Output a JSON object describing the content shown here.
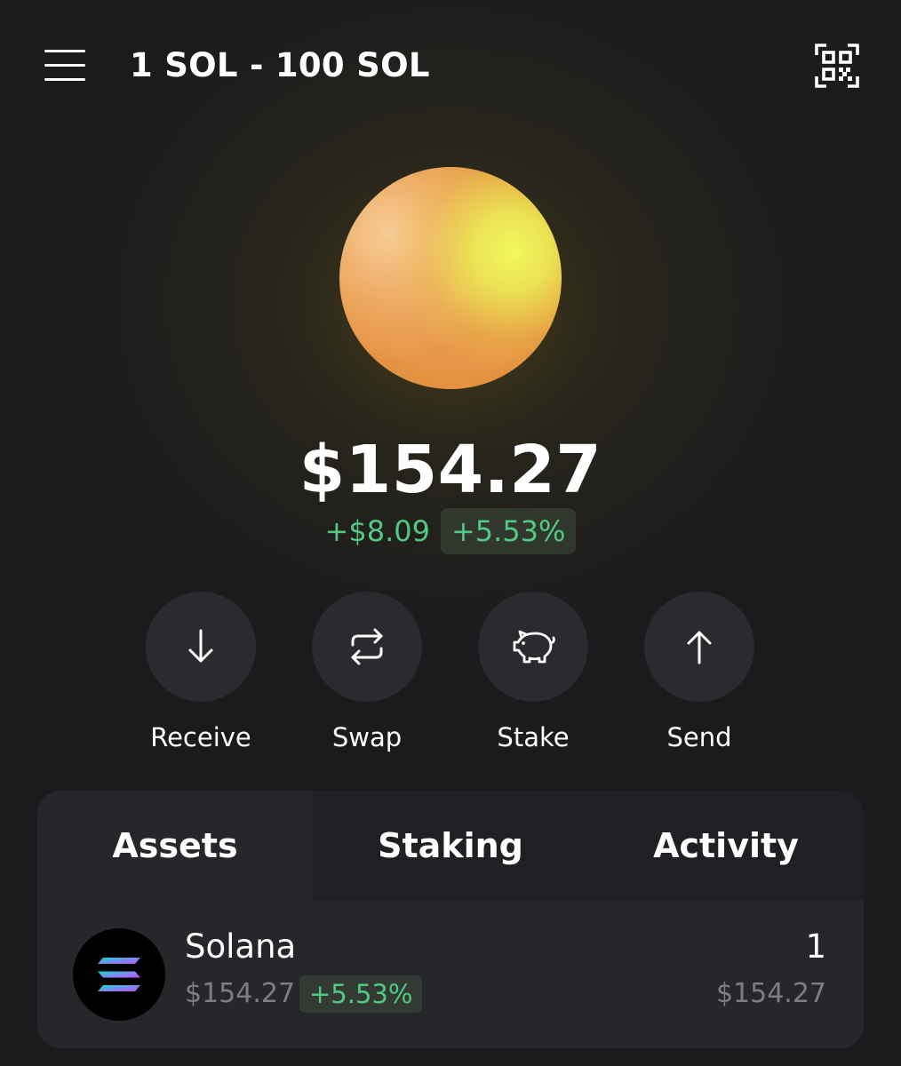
{
  "header": {
    "title": "1 SOL - 100 SOL",
    "menu_icon": "hamburger-menu-icon",
    "qr_icon": "qr-scan-icon"
  },
  "portfolio": {
    "balance": "$154.27",
    "change_amount": "+$8.09",
    "change_percent": "+5.53%",
    "positive_color": "#52c983"
  },
  "actions": [
    {
      "label": "Receive",
      "icon": "arrow-down-icon"
    },
    {
      "label": "Swap",
      "icon": "swap-arrows-icon"
    },
    {
      "label": "Stake",
      "icon": "piggy-bank-icon"
    },
    {
      "label": "Send",
      "icon": "arrow-up-icon"
    }
  ],
  "tabs": [
    {
      "label": "Assets",
      "active": true
    },
    {
      "label": "Staking",
      "active": false
    },
    {
      "label": "Activity",
      "active": false
    }
  ],
  "assets": [
    {
      "name": "Solana",
      "price": "$154.27",
      "change": "+5.53%",
      "quantity": "1",
      "value": "$154.27",
      "icon": "solana-logo-icon"
    }
  ]
}
